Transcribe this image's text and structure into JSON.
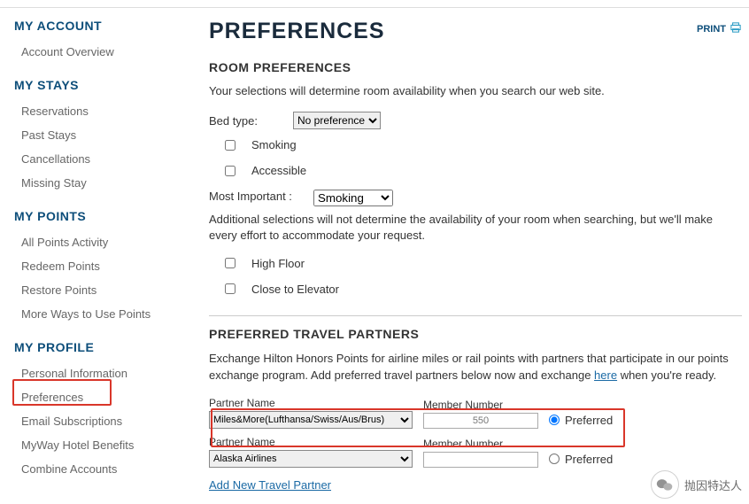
{
  "print_label": "PRINT",
  "sidebar": {
    "sections": [
      {
        "header": "MY ACCOUNT",
        "items": [
          "Account Overview"
        ]
      },
      {
        "header": "MY STAYS",
        "items": [
          "Reservations",
          "Past Stays",
          "Cancellations",
          "Missing Stay"
        ]
      },
      {
        "header": "MY POINTS",
        "items": [
          "All Points Activity",
          "Redeem Points",
          "Restore Points",
          "More Ways to Use Points"
        ]
      },
      {
        "header": "MY PROFILE",
        "items": [
          "Personal Information",
          "Preferences",
          "Email Subscriptions",
          "MyWay Hotel Benefits",
          "Combine Accounts"
        ]
      }
    ]
  },
  "page_title": "PREFERENCES",
  "room_prefs": {
    "heading": "ROOM PREFERENCES",
    "intro": "Your selections will determine room availability when you search our web site.",
    "bed_label": "Bed type:",
    "bed_selected": "No preference",
    "smoking_label": "Smoking",
    "accessible_label": "Accessible",
    "most_important_label": "Most Important :",
    "most_important_selected": "Smoking",
    "additional_note": "Additional selections will not determine the availability of your room when searching, but we'll make every effort to accommodate your request.",
    "high_floor_label": "High Floor",
    "close_elevator_label": "Close to Elevator"
  },
  "partners": {
    "heading": "PREFERRED TRAVEL PARTNERS",
    "desc_prefix": "Exchange Hilton Honors Points for airline miles or rail points with partners that participate in our points exchange program. Add preferred travel partners below now and exchange ",
    "desc_link": "here",
    "desc_suffix": " when you're ready.",
    "col_partner": "Partner Name",
    "col_member": "Member Number",
    "preferred_label": "Preferred",
    "rows": [
      {
        "name": "Miles&More(Lufthansa/Swiss/Aus/Brus)",
        "number": "550",
        "preferred": true
      },
      {
        "name": "Alaska Airlines",
        "number": "",
        "preferred": false
      }
    ],
    "add_link": "Add New Travel Partner"
  },
  "watermark_text": "抛因特达人"
}
